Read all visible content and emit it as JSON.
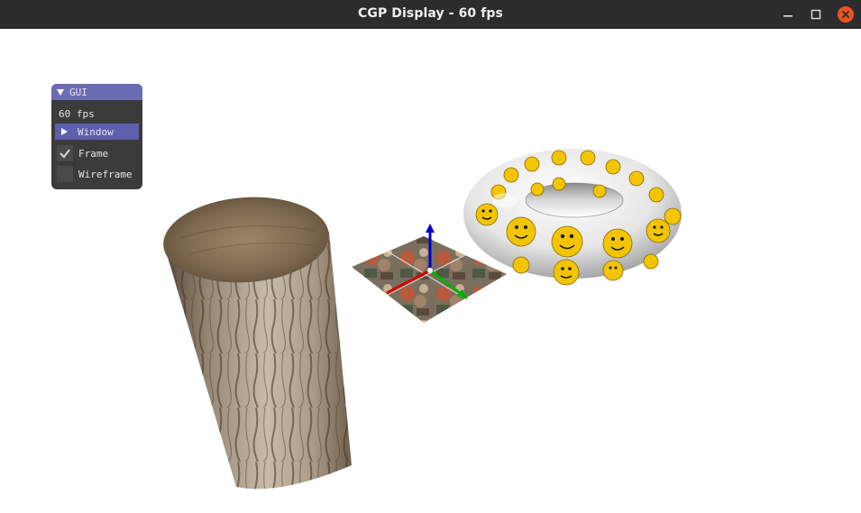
{
  "window": {
    "title": "CGP Display - 60 fps",
    "controls": [
      "minimize",
      "maximize",
      "close"
    ]
  },
  "gui": {
    "header": "GUI",
    "fps": "60 fps",
    "window_label": "Window",
    "frame_label": "Frame",
    "frame_checked": true,
    "wireframe_label": "Wireframe",
    "wireframe_checked": false
  },
  "scene": {
    "objects": [
      "textured-cylinder",
      "textured-quad",
      "smiley-torus",
      "axis-frame"
    ],
    "axis_colors": {
      "x": "#d40000",
      "y": "#00b000",
      "z": "#0000c8"
    }
  }
}
